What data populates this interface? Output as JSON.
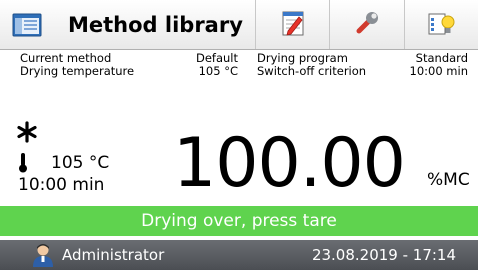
{
  "toolbar": {
    "title": "Method library",
    "icons": [
      "method-library-icon",
      "edit-notepad-icon",
      "wrench-icon",
      "settings-bulb-icon"
    ]
  },
  "info": {
    "current_method_label": "Current method",
    "current_method_value": "Default",
    "drying_temperature_label": "Drying temperature",
    "drying_temperature_value": "105 °C",
    "drying_program_label": "Drying program",
    "drying_program_value": "Standard",
    "switch_off_label": "Switch-off criterion",
    "switch_off_value": "10:00 min"
  },
  "readout": {
    "stability_symbol": "*",
    "temperature": "105 °C",
    "time": "10:00 min",
    "value": "100.00",
    "unit": "%MC"
  },
  "status": {
    "message": "Drying over, press tare",
    "color": "#5fd34e"
  },
  "footer": {
    "user": "Administrator",
    "datetime": "23.08.2019 - 17:14"
  }
}
